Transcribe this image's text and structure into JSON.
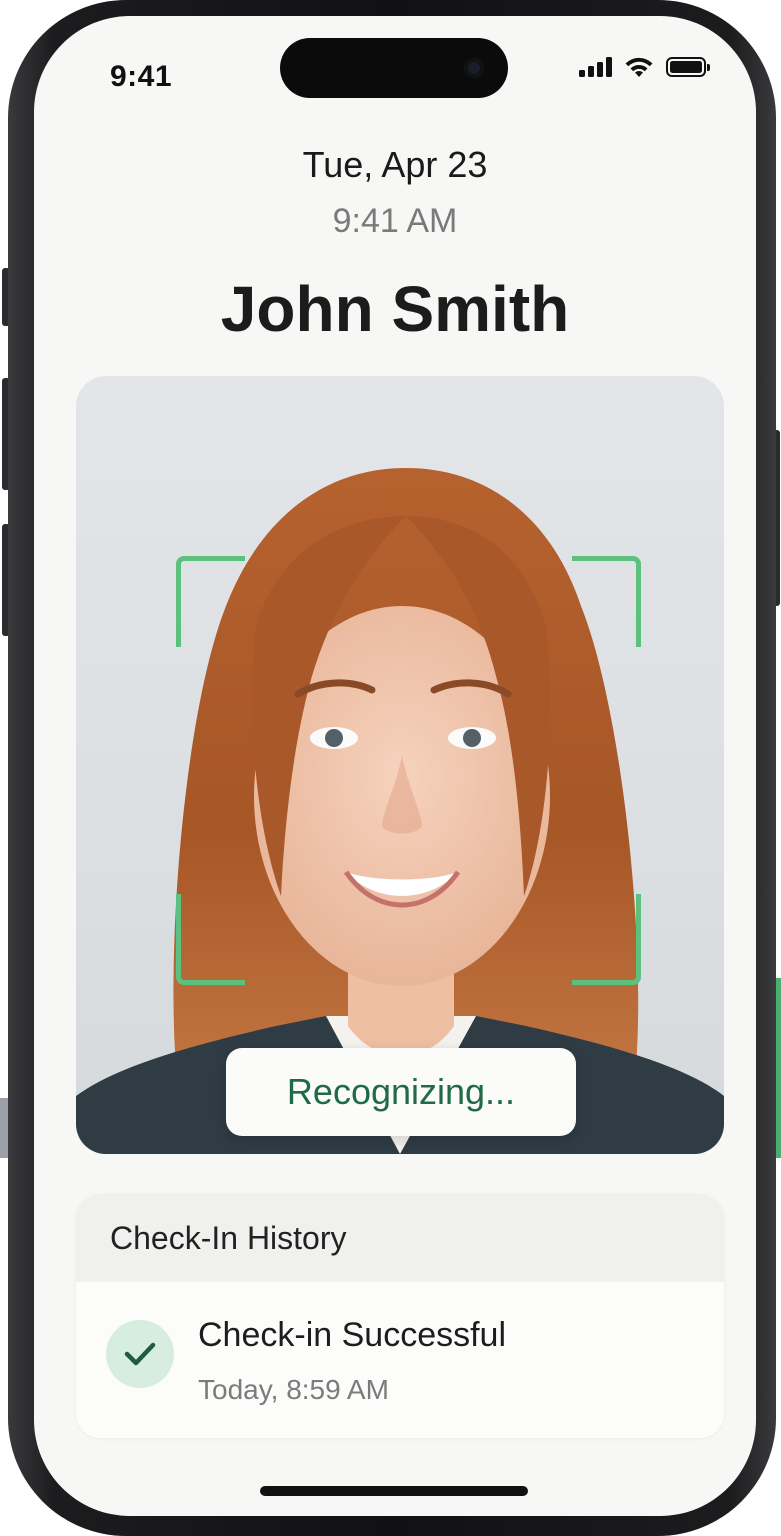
{
  "status_bar": {
    "time": "9:41",
    "signal": "signal-bars-icon",
    "wifi": "wifi-icon",
    "battery": "battery-full-icon"
  },
  "header": {
    "date": "Tue, Apr 23",
    "time": "9:41 AM",
    "name": "John Smith"
  },
  "camera": {
    "status_label": "Recognizing...",
    "frame_color": "#5cc07f",
    "scan_icon": "face-scan-frame-icon"
  },
  "history": {
    "title": "Check-In History",
    "entries": [
      {
        "title": "Check-in Successful",
        "time": "Today, 8:59 AM",
        "icon": "checkmark-icon",
        "status_color": "#1f5b3c"
      }
    ]
  },
  "theme": {
    "accent_green": "#5cc07f",
    "text_green": "#1f6b45",
    "screen_bg": "#f7f7f5"
  }
}
